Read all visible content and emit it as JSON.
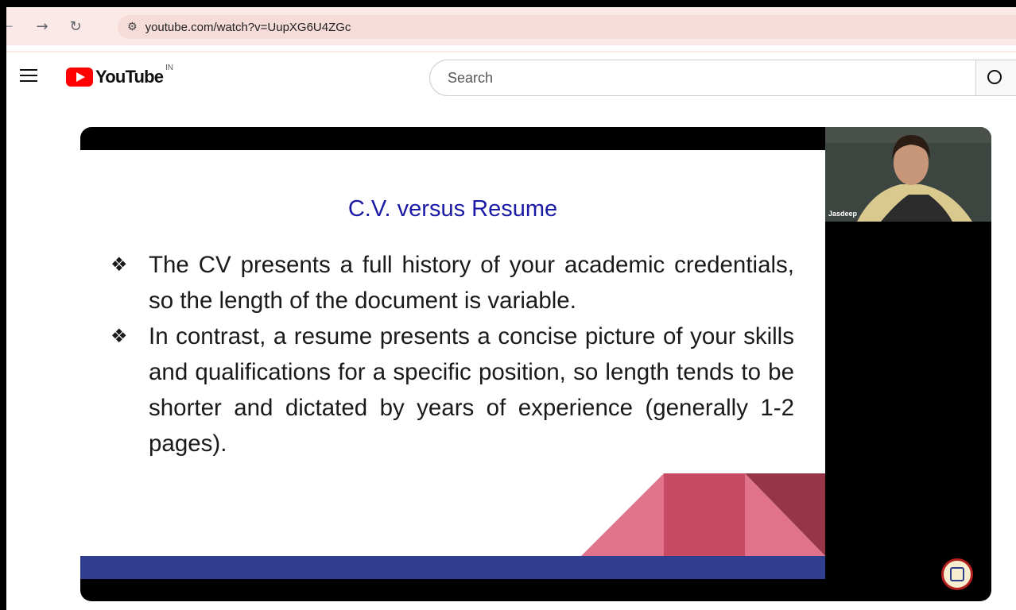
{
  "browser": {
    "url": "youtube.com/watch?v=UupXG6U4ZGc",
    "nav_icons": [
      "back-arrow-icon",
      "forward-arrow-icon",
      "reload-icon",
      "site-settings-icon"
    ]
  },
  "youtube": {
    "brand": "YouTube",
    "country": "IN",
    "search_placeholder": "Search"
  },
  "slide": {
    "title": "C.V. versus Resume",
    "bullets": [
      "The CV presents a full history of your academic credentials, so the length of the document is variable.",
      "In contrast, a resume presents a concise picture of your skills and qualifications for a specific position, so length tends to be shorter and dictated by years of experience (generally 1-2 pages)."
    ],
    "bullet_symbol": "❖",
    "colors": {
      "title": "#1a1aa6",
      "band": "#2f3e8f",
      "deco_pink": "#e0738a",
      "deco_red": "#c64a62",
      "deco_dark": "#963548"
    }
  },
  "webcam": {
    "participant_name": "Jasdeep"
  }
}
